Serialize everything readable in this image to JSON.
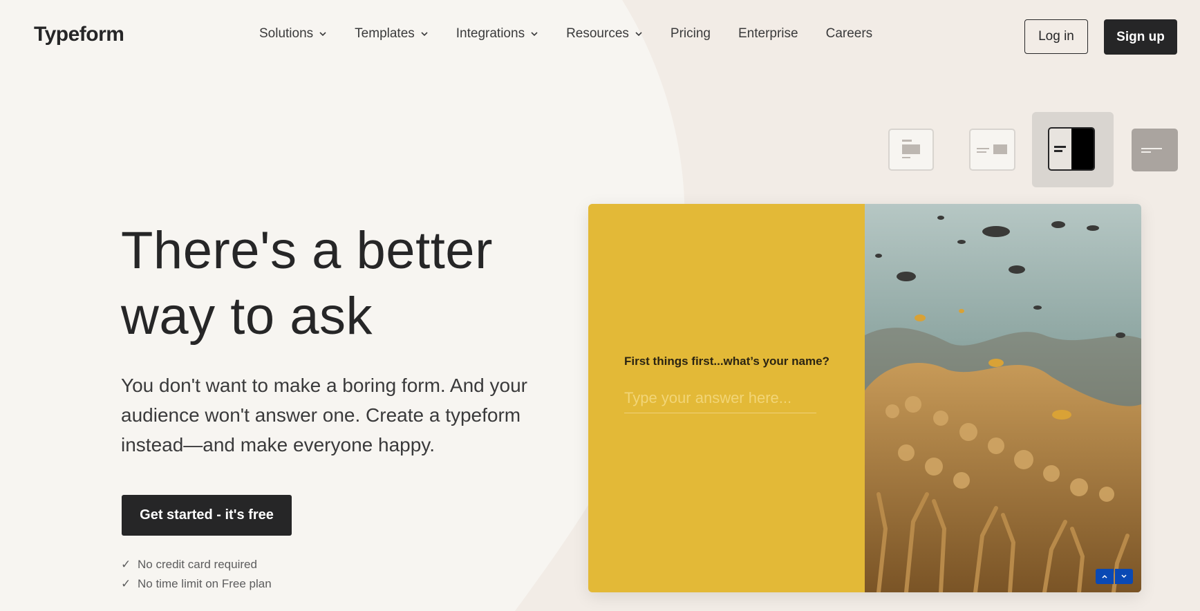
{
  "brand": {
    "logo": "Typeform"
  },
  "nav": {
    "items": [
      {
        "label": "Solutions",
        "dropdown": true
      },
      {
        "label": "Templates",
        "dropdown": true
      },
      {
        "label": "Integrations",
        "dropdown": true
      },
      {
        "label": "Resources",
        "dropdown": true
      },
      {
        "label": "Pricing",
        "dropdown": false
      },
      {
        "label": "Enterprise",
        "dropdown": false
      },
      {
        "label": "Careers",
        "dropdown": false
      }
    ],
    "login_label": "Log in",
    "signup_label": "Sign up"
  },
  "layout_picker": {
    "options": [
      "stack-left-layout-icon",
      "split-small-image-layout-icon",
      "split-image-right-layout-icon",
      "wallpaper-layout-icon"
    ],
    "selected_index": 2
  },
  "hero": {
    "title_line1": "There's a better",
    "title_line2": "way to ask",
    "subtitle": "You don't want to make a boring form. And your audience won't answer one. Create a typeform instead—and make everyone happy.",
    "cta_label": "Get started - it's free",
    "checks": [
      "No credit card required",
      "No time limit on Free plan"
    ]
  },
  "preview": {
    "question": "First things first...what’s your name?",
    "answer_placeholder": "Type your answer here...",
    "answer_value": "",
    "accent": "#e3b937",
    "nav_button_color": "#0a49b4"
  },
  "colors": {
    "background": "#f7f5f1",
    "shape": "#f2ece6",
    "dark": "#262627"
  }
}
